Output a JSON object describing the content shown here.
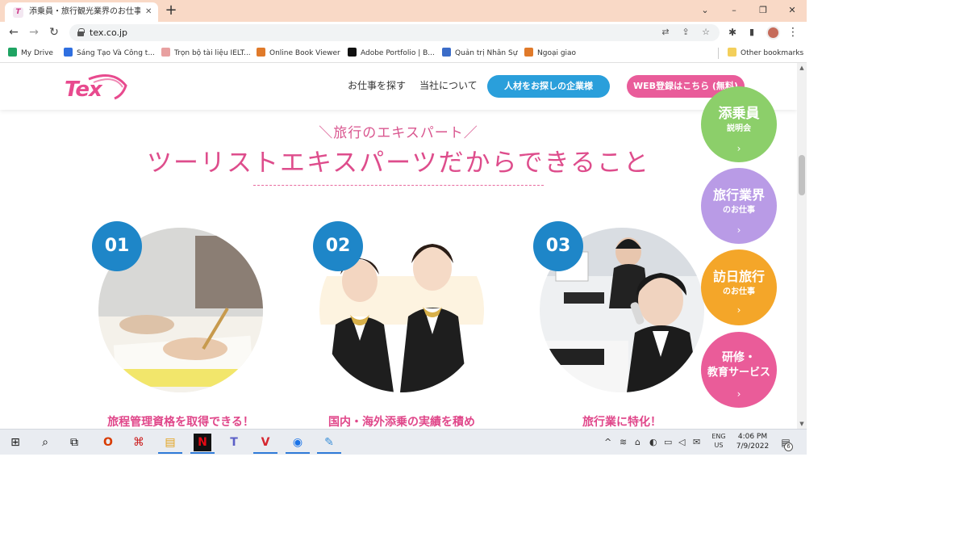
{
  "browser": {
    "tab": {
      "title": "添乗員・旅行観光業界のお仕事なら",
      "close": "✕"
    },
    "new_tab": "+",
    "window_controls": {
      "minimize": "–",
      "maximize": "❐",
      "close": "✕",
      "dropdown": "⌄"
    },
    "toolbar": {
      "back": "←",
      "forward": "→",
      "reload": "↻",
      "url": "tex.co.jp"
    },
    "omnibox_icons": {
      "translate": "⇄",
      "share": "⇪",
      "bookmark": "☆"
    },
    "extensions_icon": "✱",
    "sidebar_icon": "▮",
    "menu_icon": "⋮",
    "bookmarks": [
      {
        "label": "My Drive",
        "color": "#1fa463"
      },
      {
        "label": "Sáng Tạo Và Công t...",
        "color": "#2f6fe0"
      },
      {
        "label": "Trọn bộ tài liệu IELT...",
        "color": "#e8a0a0"
      },
      {
        "label": "Online Book Viewer",
        "color": "#e07a2a"
      },
      {
        "label": "Adobe Portfolio | B...",
        "color": "#111111"
      },
      {
        "label": "Quản trị Nhân Sự",
        "color": "#3b6cc8"
      },
      {
        "label": "Ngoại giao",
        "color": "#e07a2a"
      }
    ],
    "other_bookmarks": "Other bookmarks"
  },
  "site": {
    "logo": "Tex",
    "nav": {
      "find_job": "お仕事を探す",
      "about": "当社について"
    },
    "cta_company": "人材をお探しの企業様",
    "cta_register": "WEB登録はこちら (無料)",
    "eyebrow": "＼旅行のエキスパート／",
    "headline": "ツーリストエキスパーツだからできること",
    "features": [
      {
        "number": "01",
        "title": "旅程管理資格を取得できる！"
      },
      {
        "number": "02",
        "title": "国内・海外添乗の実績を積め"
      },
      {
        "number": "03",
        "title": "旅行業に特化！"
      }
    ],
    "side_menu": [
      {
        "main": "添乗員",
        "sub": "説明会",
        "arrow": "›",
        "color": "#8ccf6a"
      },
      {
        "main": "旅行業界",
        "sub": "のお仕事",
        "arrow": "›",
        "color": "#b99be6"
      },
      {
        "main": "訪日旅行",
        "sub": "のお仕事",
        "arrow": "›",
        "color": "#f4a629"
      },
      {
        "main": "研修・",
        "sub": "教育サービス",
        "arrow": "›",
        "color": "#ea5c99"
      }
    ]
  },
  "scrollbar": {
    "up": "▲",
    "down": "▼"
  },
  "taskbar": {
    "start": "⊞",
    "search": "⌕",
    "task_view": "⧉",
    "apps": [
      "O",
      "⌘",
      "▤",
      "N",
      "T",
      "V",
      "◉",
      "✎"
    ],
    "tray_chevron": "^",
    "tray_icons": [
      "≋",
      "⌂",
      "◐",
      "▭",
      "◁",
      "✉"
    ],
    "lang_top": "ENG",
    "lang_bottom": "US",
    "time": "4:06 PM",
    "date": "7/9/2022",
    "notif_icon": "▤",
    "notif_count": "6"
  }
}
